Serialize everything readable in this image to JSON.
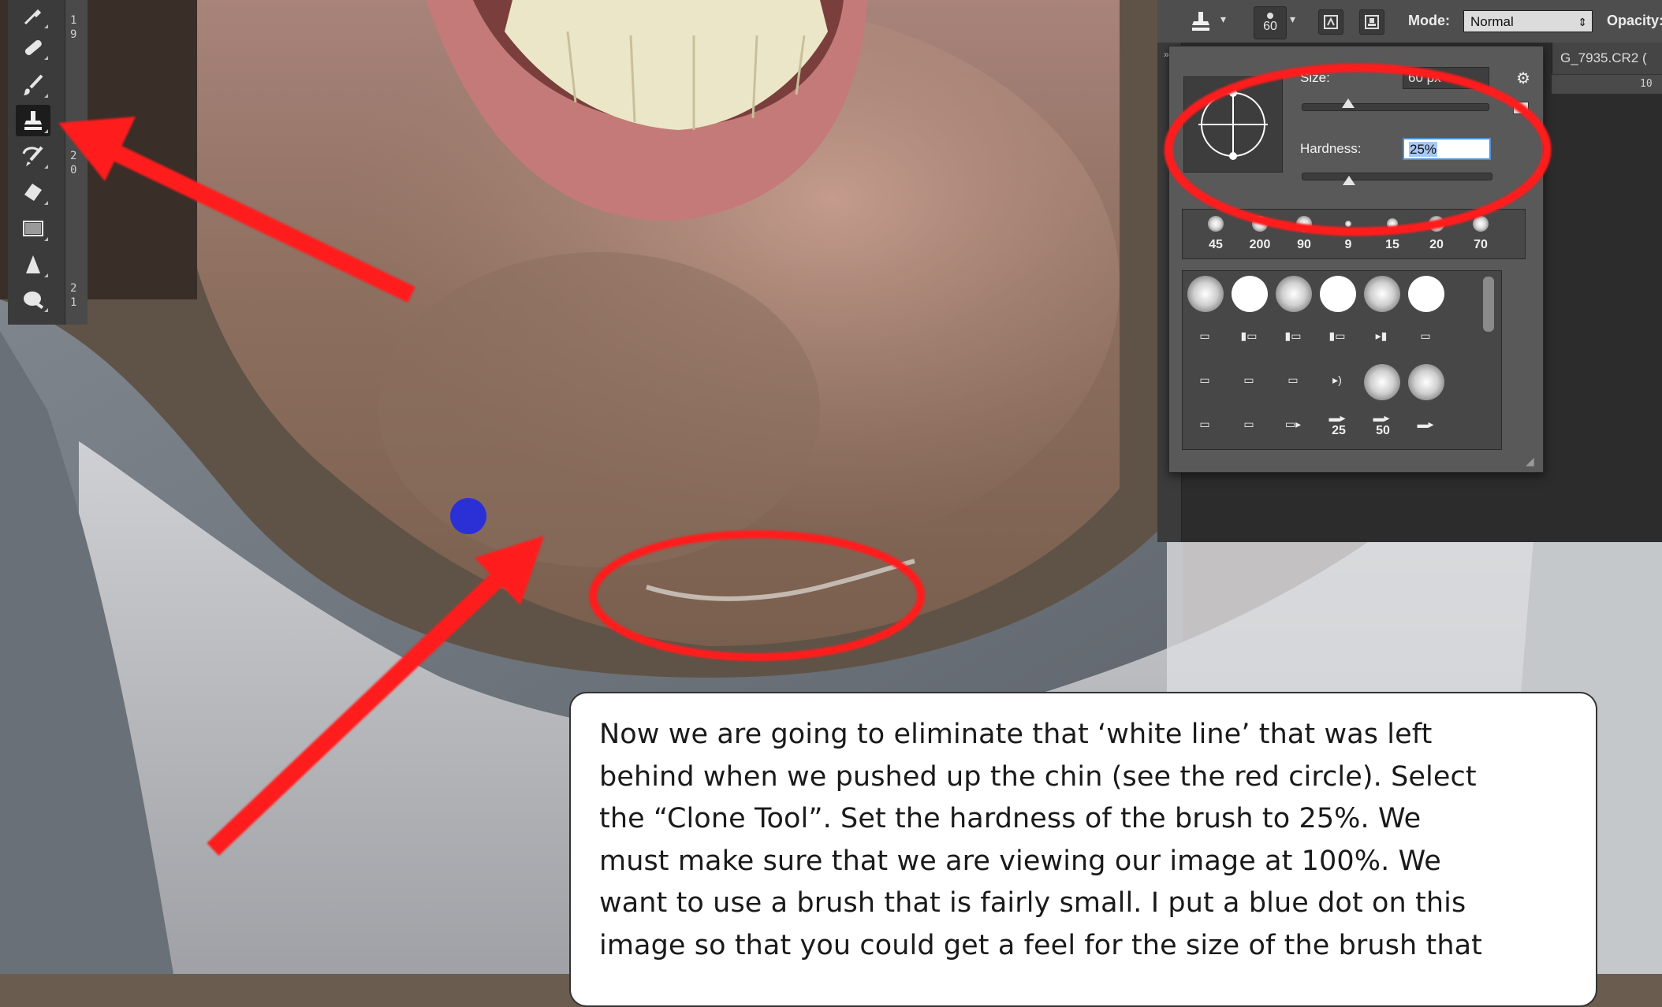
{
  "toolbar": {
    "ruler_marks": [
      "1",
      "9",
      "2",
      "0",
      "2",
      "1"
    ],
    "tools": [
      {
        "name": "eyedropper"
      },
      {
        "name": "healing-brush"
      },
      {
        "name": "brush"
      },
      {
        "name": "clone-stamp",
        "active": true
      },
      {
        "name": "history-brush"
      },
      {
        "name": "eraser"
      },
      {
        "name": "gradient"
      },
      {
        "name": "blur"
      },
      {
        "name": "dodge"
      }
    ]
  },
  "options_bar": {
    "brush_size": "60",
    "mode_label": "Mode:",
    "mode_value": "Normal",
    "opacity_label": "Opacity:"
  },
  "document": {
    "tab_label": "G_7935.CR2 (",
    "ruler_h": "10"
  },
  "brush_panel": {
    "size_label": "Size:",
    "size_value": "60 px",
    "hardness_label": "Hardness:",
    "hardness_value": "25%",
    "size_slider": 0.25,
    "hardness_slider": 0.25,
    "presets": [
      "45",
      "200",
      "90",
      "9",
      "15",
      "20",
      "70"
    ],
    "grid_numbers": [
      "25",
      "50"
    ]
  },
  "caption": {
    "lines": [
      "Now we are going to eliminate that ‘white line’ that was left",
      "behind when we pushed up the chin (see the red circle). Select",
      "the “Clone Tool”. Set the hardness of the brush to 25%. We",
      "must make sure that we are viewing our image at 100%. We",
      "want to use a brush that is fairly small. I put a blue dot on this",
      "image so that you could get a feel for the size of the brush that"
    ]
  },
  "colors": {
    "annotation_red": "#ff1a1a",
    "brush_dot_blue": "#2b2fd6",
    "panel_gray": "#595959"
  }
}
